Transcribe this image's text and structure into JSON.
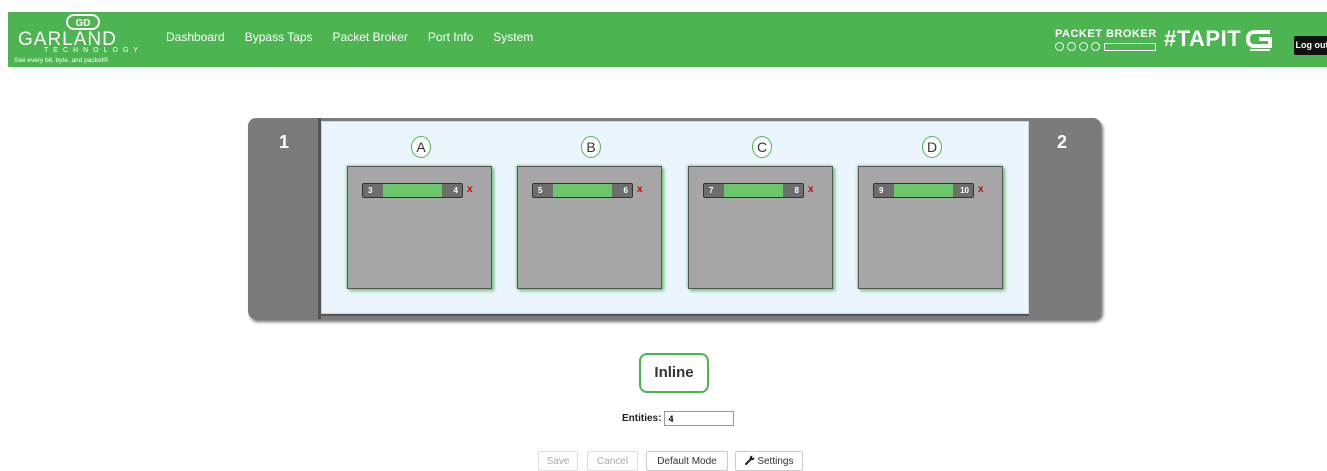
{
  "header": {
    "logo_word": "GARLAND",
    "logo_sub": "TECHNOLOGY",
    "logo_tagline": "See every bit, byte, and packet®",
    "nav": [
      "Dashboard",
      "Bypass Taps",
      "Packet Broker",
      "Port Info",
      "System"
    ],
    "brand_text": "PACKET BROKER",
    "tapit": "#TAPIT",
    "logout": "Log out"
  },
  "chassis": {
    "left_label": "1",
    "right_label": "2",
    "groups": [
      {
        "letter": "A",
        "port_left": "3",
        "port_right": "4",
        "remove": "x"
      },
      {
        "letter": "B",
        "port_left": "5",
        "port_right": "6",
        "remove": "x"
      },
      {
        "letter": "C",
        "port_left": "7",
        "port_right": "8",
        "remove": "x"
      },
      {
        "letter": "D",
        "port_left": "9",
        "port_right": "10",
        "remove": "x"
      }
    ]
  },
  "mode": {
    "label": "Inline"
  },
  "entities": {
    "label": "Entities:",
    "value": "4"
  },
  "buttons": {
    "save": "Save",
    "cancel": "Cancel",
    "default_mode": "Default Mode",
    "settings": "Settings"
  },
  "colors": {
    "brand_green": "#4cb551",
    "link_green": "#6ac56c",
    "remove_red": "#cc0000"
  }
}
